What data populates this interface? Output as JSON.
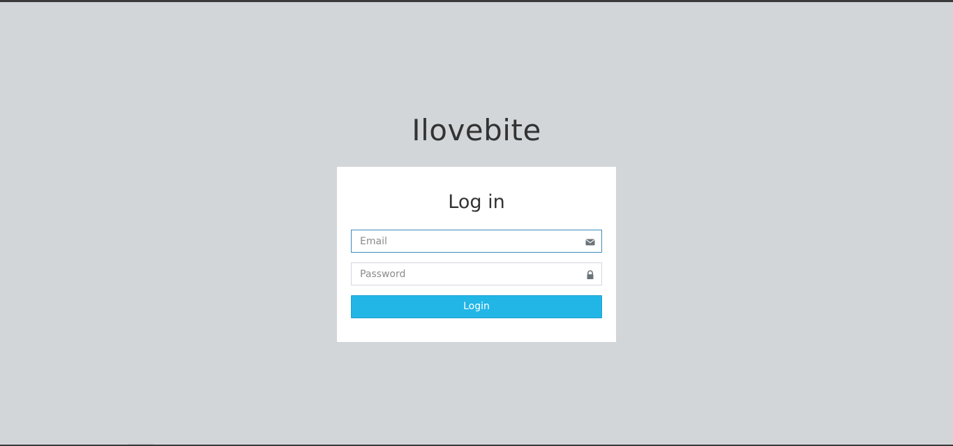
{
  "brand": {
    "title": "Ilovebite"
  },
  "login_box": {
    "title": "Log in",
    "email": {
      "placeholder": "Email",
      "value": "",
      "icon": "envelope-icon"
    },
    "password": {
      "placeholder": "Password",
      "value": "",
      "icon": "lock-icon"
    },
    "submit_label": "Login"
  },
  "colors": {
    "background": "#d2d6d9",
    "accent": "#22b6e7",
    "focus_border": "#3c8dbc"
  }
}
